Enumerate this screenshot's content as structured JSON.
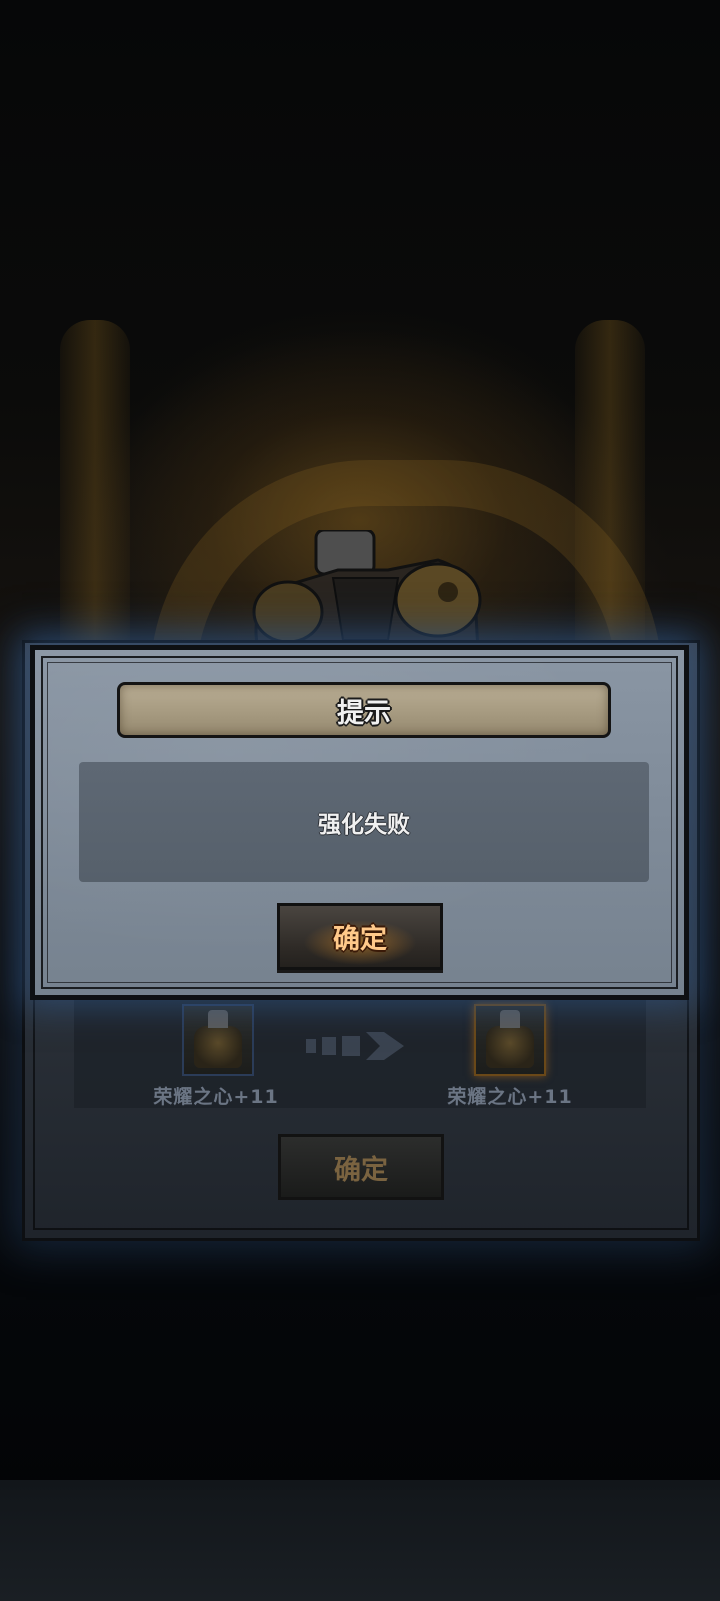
{
  "dialog": {
    "title": "提示",
    "message": "强化失败",
    "confirm_label": "确定"
  },
  "background_panel": {
    "item_from_name": "荣耀之心+11",
    "item_to_name": "荣耀之心+11",
    "confirm_label": "确定",
    "arrow_icon": "arrow-right-icon"
  },
  "colors": {
    "dialog_bg": "#7f8b99",
    "title_banner": "#a89c82",
    "confirm_text": "#ffc98a",
    "glow": "#325a8c"
  }
}
